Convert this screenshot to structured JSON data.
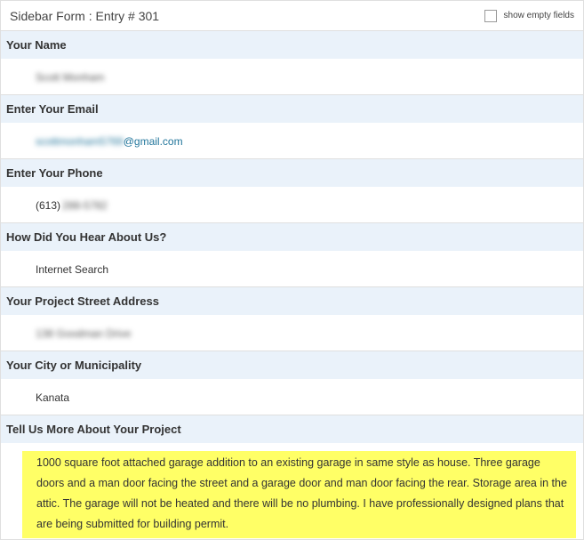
{
  "header": {
    "title": "Sidebar Form : Entry # 301",
    "show_empty_label": "show empty fields"
  },
  "fields": {
    "name": {
      "label": "Your Name",
      "value": "Scott Monham"
    },
    "email": {
      "label": "Enter Your Email",
      "value_hidden": "scottmonham5769",
      "value_domain": "@gmail.com"
    },
    "phone": {
      "label": "Enter Your Phone",
      "value_prefix": "(613)",
      "value_hidden": "288-5782"
    },
    "source": {
      "label": "How Did You Hear About Us?",
      "value": "Internet Search"
    },
    "address": {
      "label": "Your Project Street Address",
      "value": "138 Goodman Drive"
    },
    "city": {
      "label": "Your City or Municipality",
      "value": "Kanata"
    },
    "project": {
      "label": "Tell Us More About Your Project",
      "value": "1000 square foot attached garage addition to an existing garage in same style as house. Three garage doors and a man door facing the street and a garage door and man door facing the rear. Storage area in the attic. The garage will not be heated and there will be no plumbing. I have professionally designed plans that are being submitted for building permit."
    }
  },
  "colors": {
    "label_background": "#eaf2fa",
    "link": "#21759b",
    "highlight": "#ffff66"
  }
}
